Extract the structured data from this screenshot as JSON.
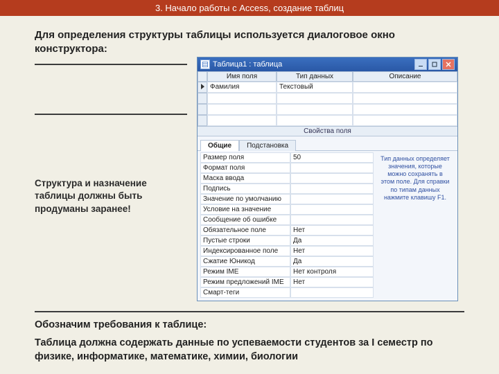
{
  "header": "3. Начало работы с Access, создание таблиц",
  "intro": "Для определения структуры таблицы используется диалоговое окно конструктора:",
  "advice": "Структура и назначение таблицы должны быть продуманы заранее!",
  "window": {
    "title": "Таблица1 : таблица",
    "columns": {
      "name": "Имя поля",
      "type": "Тип данных",
      "desc": "Описание"
    },
    "row1": {
      "name": "Фамилия",
      "type": "Текстовый",
      "desc": ""
    },
    "propsLabel": "Свойства поля",
    "tabs": {
      "general": "Общие",
      "lookup": "Подстановка"
    },
    "props": {
      "p1": {
        "label": "Размер поля",
        "val": "50"
      },
      "p2": {
        "label": "Формат поля",
        "val": ""
      },
      "p3": {
        "label": "Маска ввода",
        "val": ""
      },
      "p4": {
        "label": "Подпись",
        "val": ""
      },
      "p5": {
        "label": "Значение по умолчанию",
        "val": ""
      },
      "p6": {
        "label": "Условие на значение",
        "val": ""
      },
      "p7": {
        "label": "Сообщение об ошибке",
        "val": ""
      },
      "p8": {
        "label": "Обязательное поле",
        "val": "Нет"
      },
      "p9": {
        "label": "Пустые строки",
        "val": "Да"
      },
      "p10": {
        "label": "Индексированное поле",
        "val": "Нет"
      },
      "p11": {
        "label": "Сжатие Юникод",
        "val": "Да"
      },
      "p12": {
        "label": "Режим IME",
        "val": "Нет контроля"
      },
      "p13": {
        "label": "Режим предложений IME",
        "val": "Нет"
      },
      "p14": {
        "label": "Смарт-теги",
        "val": ""
      }
    },
    "help": "Тип данных определяет значения, которые можно сохранять в этом поле. Для справки по типам данных нажмите клавишу F1."
  },
  "reqTitle": "Обозначим требования к таблице:",
  "reqBody": "Таблица должна содержать данные по успеваемости студентов за  I семестр по физике, информатике, математике, химии, биологии"
}
